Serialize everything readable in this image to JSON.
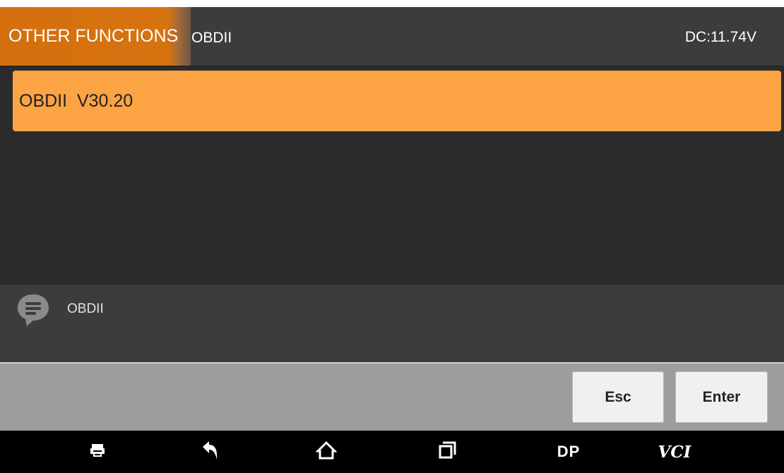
{
  "header": {
    "tab_label": "OTHER FUNCTIONS",
    "breadcrumb": "OBDII",
    "voltage": "DC:11.74V"
  },
  "list": {
    "items": [
      {
        "label": "OBDII  V30.20",
        "selected": true
      }
    ]
  },
  "message": {
    "icon": "chat-bubble-icon",
    "text": "OBDII"
  },
  "buttons": {
    "esc_label": "Esc",
    "enter_label": "Enter"
  },
  "navbar": {
    "items": [
      {
        "icon": "printer-icon"
      },
      {
        "icon": "back-icon"
      },
      {
        "icon": "home-icon"
      },
      {
        "icon": "recent-apps-icon"
      },
      {
        "icon": "dp-icon",
        "label": "DP"
      },
      {
        "icon": "vci-icon",
        "label": "VCI"
      }
    ]
  },
  "colors": {
    "accent": "#d7730f",
    "selected_item": "#fca344",
    "background": "#2b2b2b",
    "header": "#3c3c3c",
    "button_bar": "#9d9d9d"
  }
}
